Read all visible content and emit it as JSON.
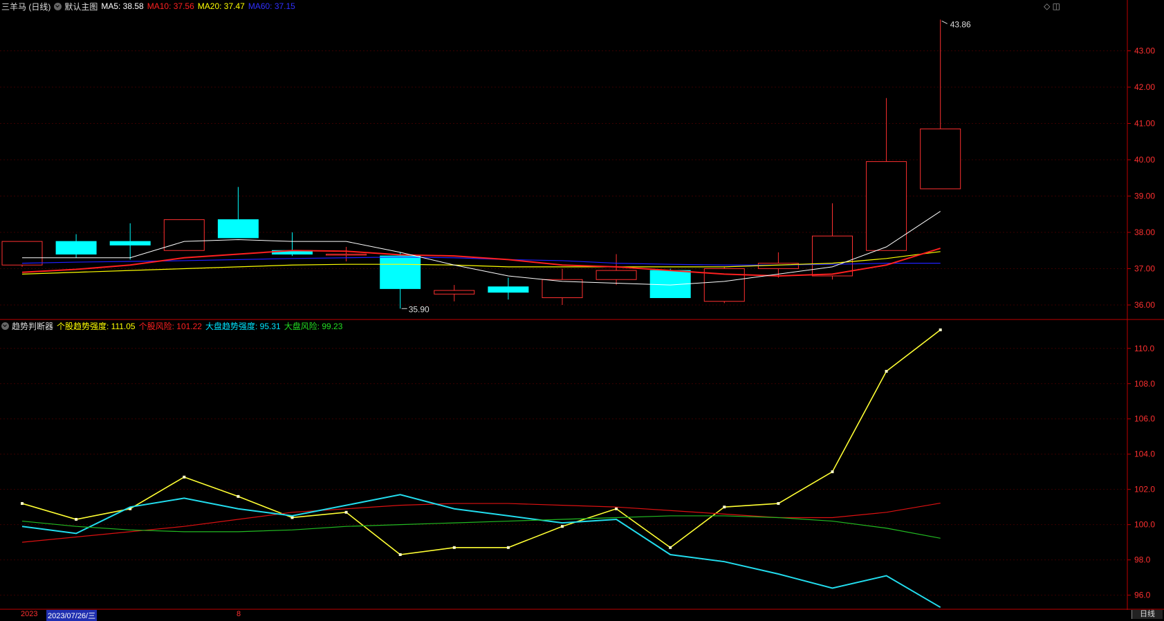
{
  "top_header": {
    "stock": "三羊马 (日线)",
    "template": "默认主图",
    "ma5": "MA5: 38.58",
    "ma10": "MA10: 37.56",
    "ma20": "MA20: 37.47",
    "ma60": "MA60: 37.15"
  },
  "bottom_header": {
    "indicator": "趋势判断器",
    "stock_trend": "个股趋势强度: 111.05",
    "stock_risk": "个股风险: 101.22",
    "market_trend": "大盘趋势强度: 95.31",
    "market_risk": "大盘风险: 99.23"
  },
  "icons": {
    "top_right": "◇ ◫"
  },
  "bottom_bar": {
    "date_a": "2023",
    "date_b": "2023/07/26/三",
    "date_c": "8",
    "period_tab": "日线"
  },
  "colors": {
    "up": "#ff3030",
    "down": "#00ffff",
    "ma5": "#ffffff",
    "ma10": "#ff2020",
    "ma20": "#ffff00",
    "ma60": "#2020ff",
    "market_risk": "#22cc22",
    "axis": "#c00000"
  },
  "chart_data": [
    {
      "type": "candlestick",
      "ylim": [
        35.6,
        44.4
      ],
      "yticks": [
        36,
        37,
        38,
        39,
        40,
        41,
        42,
        43
      ],
      "high_label": "43.86",
      "low_label": "35.90",
      "candles": [
        {
          "o": 37.1,
          "h": 37.75,
          "l": 37.05,
          "c": 37.75
        },
        {
          "o": 37.75,
          "h": 37.95,
          "l": 37.3,
          "c": 37.4
        },
        {
          "o": 37.75,
          "h": 38.25,
          "l": 37.25,
          "c": 37.65
        },
        {
          "o": 37.5,
          "h": 38.35,
          "l": 37.5,
          "c": 38.35
        },
        {
          "o": 38.35,
          "h": 39.25,
          "l": 37.85,
          "c": 37.85
        },
        {
          "o": 37.5,
          "h": 38.0,
          "l": 37.35,
          "c": 37.4
        },
        {
          "o": 37.4,
          "h": 37.6,
          "l": 37.2,
          "c": 37.4
        },
        {
          "o": 37.35,
          "h": 37.45,
          "l": 35.9,
          "c": 36.45
        },
        {
          "o": 36.3,
          "h": 36.55,
          "l": 36.1,
          "c": 36.4
        },
        {
          "o": 36.5,
          "h": 36.75,
          "l": 36.15,
          "c": 36.35
        },
        {
          "o": 36.2,
          "h": 37.0,
          "l": 36.0,
          "c": 36.7
        },
        {
          "o": 36.7,
          "h": 37.4,
          "l": 36.55,
          "c": 36.95
        },
        {
          "o": 36.95,
          "h": 37.0,
          "l": 36.2,
          "c": 36.2
        },
        {
          "o": 36.1,
          "h": 37.05,
          "l": 36.05,
          "c": 37.0
        },
        {
          "o": 37.0,
          "h": 37.45,
          "l": 36.75,
          "c": 37.15
        },
        {
          "o": 36.8,
          "h": 38.8,
          "l": 36.7,
          "c": 37.9
        },
        {
          "o": 37.5,
          "h": 41.7,
          "l": 37.5,
          "c": 39.95
        },
        {
          "o": 39.2,
          "h": 43.86,
          "l": 39.2,
          "c": 40.85
        }
      ],
      "ma5": {
        "start": 0,
        "values": [
          37.3,
          37.3,
          37.3,
          37.75,
          37.8,
          37.75,
          37.75,
          37.45,
          37.1,
          36.8,
          36.65,
          36.6,
          36.55,
          36.65,
          36.85,
          37.05,
          37.6,
          38.58
        ]
      },
      "ma10": {
        "start": 0,
        "values": [
          36.9,
          36.98,
          37.1,
          37.3,
          37.4,
          37.5,
          37.48,
          37.38,
          37.35,
          37.25,
          37.1,
          37.05,
          36.95,
          36.85,
          36.8,
          36.85,
          37.1,
          37.56
        ]
      },
      "ma20": {
        "start": 0,
        "values": [
          36.85,
          36.9,
          36.95,
          37.0,
          37.05,
          37.1,
          37.12,
          37.12,
          37.1,
          37.05,
          37.05,
          37.05,
          37.05,
          37.05,
          37.1,
          37.15,
          37.28,
          37.47
        ]
      },
      "ma60": {
        "start": 0,
        "values": [
          37.15,
          37.18,
          37.2,
          37.22,
          37.25,
          37.28,
          37.3,
          37.32,
          37.3,
          37.25,
          37.22,
          37.15,
          37.12,
          37.1,
          37.1,
          37.12,
          37.15,
          37.15
        ]
      }
    },
    {
      "type": "line",
      "ylim": [
        95.2,
        111.6
      ],
      "yticks": [
        96,
        98,
        100,
        102,
        104,
        106,
        108,
        110
      ],
      "series": [
        {
          "name": "个股趋势强度",
          "values": [
            101.2,
            100.3,
            100.9,
            102.7,
            101.6,
            100.4,
            100.7,
            98.3,
            98.7,
            98.7,
            99.9,
            100.9,
            98.7,
            101.0,
            101.2,
            103.0,
            108.7,
            111.05
          ]
        },
        {
          "name": "个股风险",
          "values": [
            99.0,
            99.3,
            99.6,
            99.9,
            100.3,
            100.7,
            100.9,
            101.1,
            101.2,
            101.2,
            101.1,
            101.0,
            100.8,
            100.6,
            100.4,
            100.4,
            100.7,
            101.22
          ]
        },
        {
          "name": "大盘趋势强度",
          "values": [
            99.9,
            99.5,
            101.0,
            101.5,
            100.9,
            100.5,
            101.1,
            101.7,
            100.9,
            100.5,
            100.1,
            100.3,
            98.3,
            97.9,
            97.2,
            96.4,
            97.1,
            95.31
          ]
        },
        {
          "name": "大盘风险",
          "values": [
            100.2,
            99.9,
            99.7,
            99.6,
            99.6,
            99.7,
            99.9,
            100.0,
            100.1,
            100.2,
            100.3,
            100.4,
            100.5,
            100.5,
            100.4,
            100.2,
            99.8,
            99.23
          ]
        }
      ]
    }
  ]
}
